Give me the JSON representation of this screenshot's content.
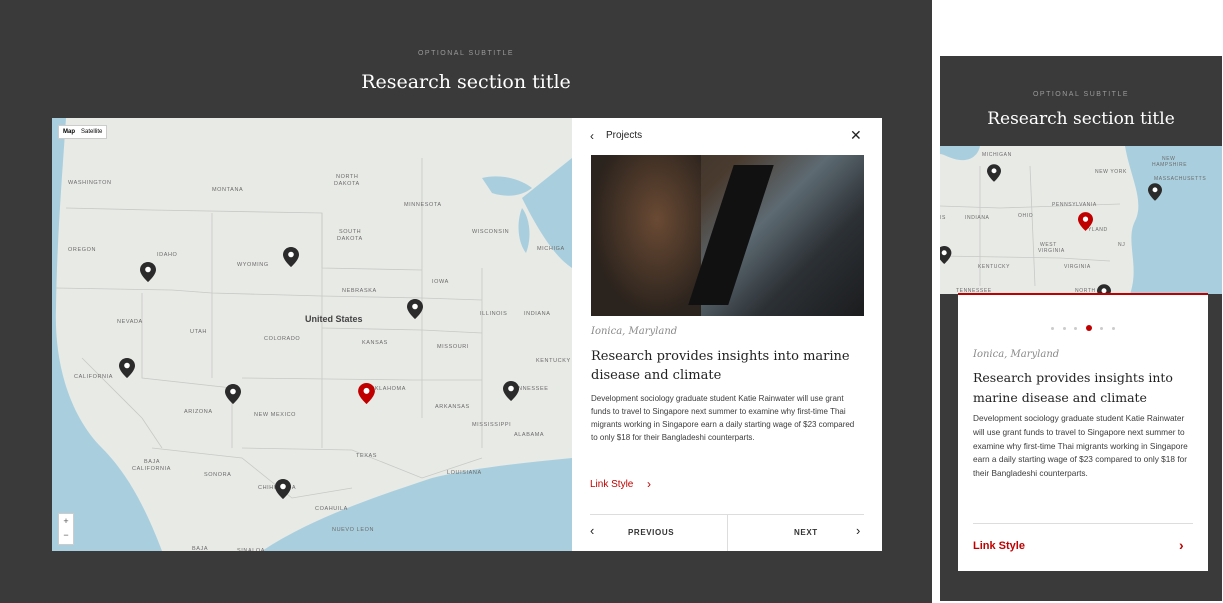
{
  "desktop": {
    "subtitle": "OPTIONAL SUBTITLE",
    "title": "Research section title",
    "map": {
      "toggle": [
        "Map",
        "Satellite"
      ],
      "country_label": "United States",
      "state_labels": [
        "WASHINGTON",
        "MONTANA",
        "NORTH DAKOTA",
        "MINNESOTA",
        "OREGON",
        "IDAHO",
        "WYOMING",
        "SOUTH DAKOTA",
        "WISCONSIN",
        "MICHIGA",
        "IOWA",
        "NEBRASKA",
        "NEVADA",
        "UTAH",
        "COLORADO",
        "KANSAS",
        "MISSOURI",
        "ILLINOIS",
        "INDIANA",
        "KENTUCKY",
        "CALIFORNIA",
        "ARIZONA",
        "NEW MEXICO",
        "OKLAHOMA",
        "ARKANSAS",
        "NNESSEE",
        "MISSISSIPPI",
        "ALABAMA",
        "TEXAS",
        "LOUISIANA",
        "BAJA CALIFORNIA",
        "SONORA",
        "CHIHUAHUA",
        "COAHUILA",
        "NUEVO LEON",
        "BAJA",
        "SINALOA"
      ],
      "zoom_in": "+",
      "zoom_out": "−"
    },
    "panel": {
      "back_label": "Projects",
      "location": "Ionica, Maryland",
      "headline": "Research provides insights into marine disease and climate",
      "body": "Development sociology graduate student Katie Rainwater will use grant funds to travel to Singapore next summer to examine why first-time Thai migrants working in Singapore earn a daily starting wage of $23 compared to only $18 for their Bangladeshi counterparts.",
      "link": "Link Style",
      "prev": "PREVIOUS",
      "next": "NEXT"
    }
  },
  "mobile": {
    "subtitle": "OPTIONAL SUBTITLE",
    "title": "Research section title",
    "map_labels": [
      "MICHIGAN",
      "NEW YORK",
      "NEW HAMPSHIRE",
      "MASSACHUSETTS",
      "PENNSYLVANIA",
      "INDIANA",
      "OHIO",
      "MARYLAND",
      "WEST VIRGINIA",
      "KENTUCKY",
      "VIRGINIA",
      "TENNESSEE",
      "NORTH"
    ],
    "location": "Ionica, Maryland",
    "headline": "Research provides insights into marine disease and climate",
    "body": "Development sociology graduate student Katie Rainwater will use grant funds to travel to Singapore next summer to examine why first-time Thai migrants working in Singapore earn a daily starting wage of $23 compared to only $18 for their Bangladeshi counterparts.",
    "link": "Link Style",
    "carousel_active": 4,
    "carousel_count": 6
  },
  "colors": {
    "frame": "#3a3a3a",
    "accent": "#c00000",
    "pin": "#2b2b2b",
    "water": "#a9cfdf"
  }
}
